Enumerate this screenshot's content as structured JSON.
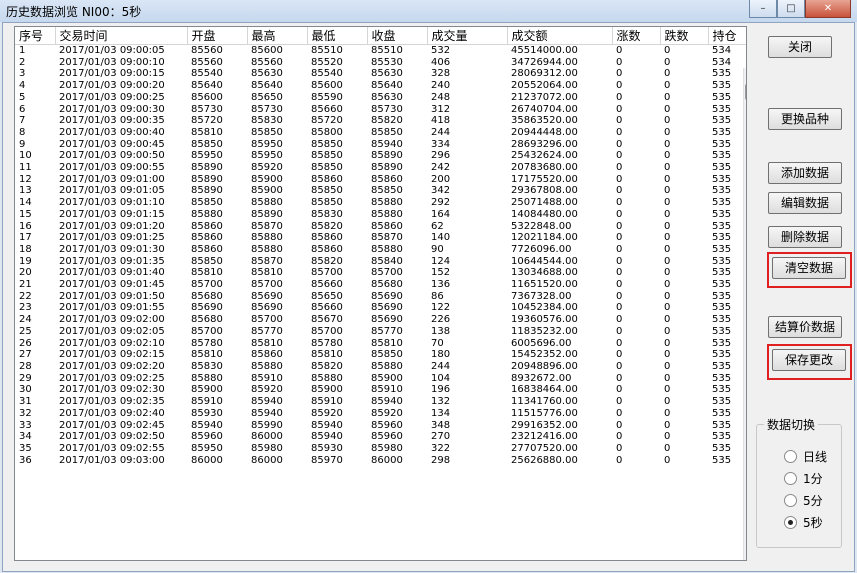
{
  "window": {
    "title": "历史数据浏览 NI00：5秒",
    "min": "–",
    "max": "□",
    "close": "✕"
  },
  "grid": {
    "columns": [
      "序号",
      "交易时间",
      "开盘",
      "最高",
      "最低",
      "收盘",
      "成交量",
      "成交额",
      "涨数",
      "跌数",
      "持仓"
    ],
    "rows": [
      [
        "1",
        "2017/01/03  09:00:05",
        "85560",
        "85600",
        "85510",
        "85510",
        "532",
        "45514000.00",
        "0",
        "0",
        "534"
      ],
      [
        "2",
        "2017/01/03  09:00:10",
        "85560",
        "85560",
        "85520",
        "85530",
        "406",
        "34726944.00",
        "0",
        "0",
        "534"
      ],
      [
        "3",
        "2017/01/03  09:00:15",
        "85540",
        "85630",
        "85540",
        "85630",
        "328",
        "28069312.00",
        "0",
        "0",
        "535"
      ],
      [
        "4",
        "2017/01/03  09:00:20",
        "85640",
        "85640",
        "85600",
        "85640",
        "240",
        "20552064.00",
        "0",
        "0",
        "535"
      ],
      [
        "5",
        "2017/01/03  09:00:25",
        "85600",
        "85650",
        "85590",
        "85630",
        "248",
        "21237072.00",
        "0",
        "0",
        "535"
      ],
      [
        "6",
        "2017/01/03  09:00:30",
        "85730",
        "85730",
        "85660",
        "85730",
        "312",
        "26740704.00",
        "0",
        "0",
        "535"
      ],
      [
        "7",
        "2017/01/03  09:00:35",
        "85720",
        "85830",
        "85720",
        "85820",
        "418",
        "35863520.00",
        "0",
        "0",
        "535"
      ],
      [
        "8",
        "2017/01/03  09:00:40",
        "85810",
        "85850",
        "85800",
        "85850",
        "244",
        "20944448.00",
        "0",
        "0",
        "535"
      ],
      [
        "9",
        "2017/01/03  09:00:45",
        "85850",
        "85950",
        "85850",
        "85940",
        "334",
        "28693296.00",
        "0",
        "0",
        "535"
      ],
      [
        "10",
        "2017/01/03  09:00:50",
        "85950",
        "85950",
        "85850",
        "85890",
        "296",
        "25432624.00",
        "0",
        "0",
        "535"
      ],
      [
        "11",
        "2017/01/03  09:00:55",
        "85890",
        "85920",
        "85850",
        "85890",
        "242",
        "20783680.00",
        "0",
        "0",
        "535"
      ],
      [
        "12",
        "2017/01/03  09:01:00",
        "85890",
        "85900",
        "85860",
        "85860",
        "200",
        "17175520.00",
        "0",
        "0",
        "535"
      ],
      [
        "13",
        "2017/01/03  09:01:05",
        "85890",
        "85900",
        "85850",
        "85850",
        "342",
        "29367808.00",
        "0",
        "0",
        "535"
      ],
      [
        "14",
        "2017/01/03  09:01:10",
        "85850",
        "85880",
        "85850",
        "85880",
        "292",
        "25071488.00",
        "0",
        "0",
        "535"
      ],
      [
        "15",
        "2017/01/03  09:01:15",
        "85880",
        "85890",
        "85830",
        "85880",
        "164",
        "14084480.00",
        "0",
        "0",
        "535"
      ],
      [
        "16",
        "2017/01/03  09:01:20",
        "85860",
        "85870",
        "85820",
        "85860",
        "62",
        "5322848.00",
        "0",
        "0",
        "535"
      ],
      [
        "17",
        "2017/01/03  09:01:25",
        "85860",
        "85880",
        "85860",
        "85870",
        "140",
        "12021184.00",
        "0",
        "0",
        "535"
      ],
      [
        "18",
        "2017/01/03  09:01:30",
        "85860",
        "85880",
        "85860",
        "85880",
        "90",
        "7726096.00",
        "0",
        "0",
        "535"
      ],
      [
        "19",
        "2017/01/03  09:01:35",
        "85850",
        "85870",
        "85820",
        "85840",
        "124",
        "10644544.00",
        "0",
        "0",
        "535"
      ],
      [
        "20",
        "2017/01/03  09:01:40",
        "85810",
        "85810",
        "85700",
        "85700",
        "152",
        "13034688.00",
        "0",
        "0",
        "535"
      ],
      [
        "21",
        "2017/01/03  09:01:45",
        "85700",
        "85700",
        "85660",
        "85680",
        "136",
        "11651520.00",
        "0",
        "0",
        "535"
      ],
      [
        "22",
        "2017/01/03  09:01:50",
        "85680",
        "85690",
        "85650",
        "85690",
        "86",
        "7367328.00",
        "0",
        "0",
        "535"
      ],
      [
        "23",
        "2017/01/03  09:01:55",
        "85690",
        "85690",
        "85660",
        "85690",
        "122",
        "10452384.00",
        "0",
        "0",
        "535"
      ],
      [
        "24",
        "2017/01/03  09:02:00",
        "85680",
        "85700",
        "85670",
        "85690",
        "226",
        "19360576.00",
        "0",
        "0",
        "535"
      ],
      [
        "25",
        "2017/01/03  09:02:05",
        "85700",
        "85770",
        "85700",
        "85770",
        "138",
        "11835232.00",
        "0",
        "0",
        "535"
      ],
      [
        "26",
        "2017/01/03  09:02:10",
        "85780",
        "85810",
        "85780",
        "85810",
        "70",
        "6005696.00",
        "0",
        "0",
        "535"
      ],
      [
        "27",
        "2017/01/03  09:02:15",
        "85810",
        "85860",
        "85810",
        "85850",
        "180",
        "15452352.00",
        "0",
        "0",
        "535"
      ],
      [
        "28",
        "2017/01/03  09:02:20",
        "85830",
        "85880",
        "85820",
        "85880",
        "244",
        "20948896.00",
        "0",
        "0",
        "535"
      ],
      [
        "29",
        "2017/01/03  09:02:25",
        "85880",
        "85910",
        "85880",
        "85900",
        "104",
        "8932672.00",
        "0",
        "0",
        "535"
      ],
      [
        "30",
        "2017/01/03  09:02:30",
        "85900",
        "85920",
        "85900",
        "85910",
        "196",
        "16838464.00",
        "0",
        "0",
        "535"
      ],
      [
        "31",
        "2017/01/03  09:02:35",
        "85910",
        "85940",
        "85910",
        "85940",
        "132",
        "11341760.00",
        "0",
        "0",
        "535"
      ],
      [
        "32",
        "2017/01/03  09:02:40",
        "85930",
        "85940",
        "85920",
        "85920",
        "134",
        "11515776.00",
        "0",
        "0",
        "535"
      ],
      [
        "33",
        "2017/01/03  09:02:45",
        "85940",
        "85990",
        "85940",
        "85960",
        "348",
        "29916352.00",
        "0",
        "0",
        "535"
      ],
      [
        "34",
        "2017/01/03  09:02:50",
        "85960",
        "86000",
        "85940",
        "85960",
        "270",
        "23212416.00",
        "0",
        "0",
        "535"
      ],
      [
        "35",
        "2017/01/03  09:02:55",
        "85950",
        "85980",
        "85930",
        "85980",
        "322",
        "27707520.00",
        "0",
        "0",
        "535"
      ],
      [
        "36",
        "2017/01/03  09:03:00",
        "86000",
        "86000",
        "85970",
        "86000",
        "298",
        "25626880.00",
        "0",
        "0",
        "535"
      ]
    ]
  },
  "buttons": {
    "close": "关闭",
    "change_product": "更换品种",
    "add": "添加数据",
    "edit": "编辑数据",
    "delete": "删除数据",
    "clear": "清空数据",
    "settlement": "结算价数据",
    "save": "保存更改"
  },
  "switch_group": {
    "title": "数据切换",
    "options": [
      "日线",
      "1分",
      "5分",
      "5秒"
    ],
    "selected": "5秒"
  },
  "highlight_color": "#e02020"
}
